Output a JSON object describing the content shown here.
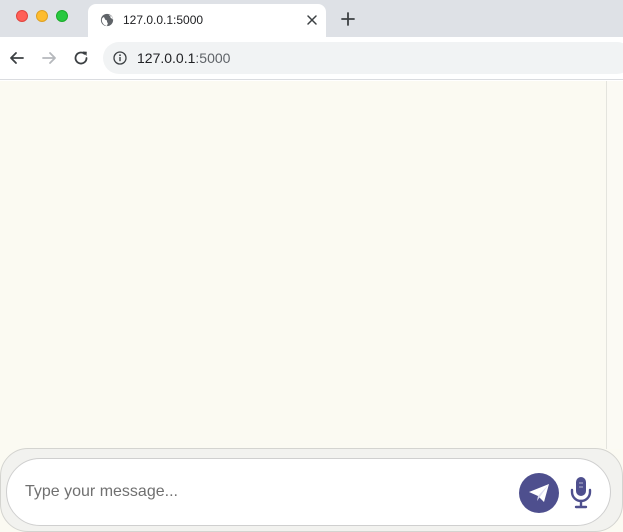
{
  "browser": {
    "tab": {
      "title": "127.0.0.1:5000",
      "favicon_icon": "globe-icon"
    },
    "address_bar": {
      "host": "127.0.0.1",
      "port": ":5000",
      "info_icon": "info-icon"
    },
    "nav_icons": [
      "back-arrow-icon",
      "forward-arrow-icon",
      "reload-icon"
    ],
    "new_tab_icon": "plus-icon",
    "close_tab_icon": "close-icon"
  },
  "composer": {
    "placeholder": "Type your message...",
    "value": "",
    "send_icon": "paper-plane-icon",
    "mic_icon": "microphone-icon"
  },
  "colors": {
    "page_background": "#fbfaf2",
    "send_button": "#4e4f8e",
    "mic_icon": "#4e4f8e"
  }
}
